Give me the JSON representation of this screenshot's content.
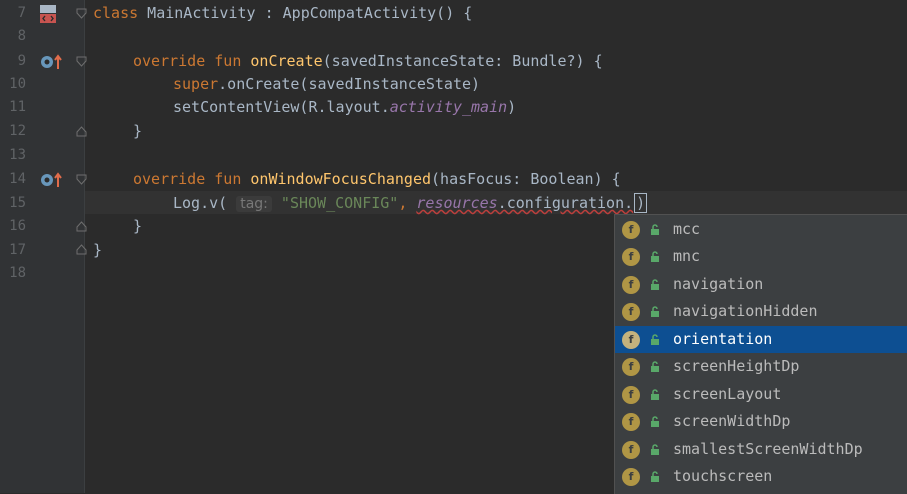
{
  "gutter": {
    "line_numbers": [
      "7",
      "8",
      "9",
      "10",
      "11",
      "12",
      "13",
      "14",
      "15",
      "16",
      "17",
      "18"
    ]
  },
  "code": {
    "line7": {
      "kw": "class",
      "rest": " MainActivity : AppCompatActivity() {"
    },
    "line9": {
      "kw": "override fun ",
      "fn": "onCreate",
      "rest": "(savedInstanceState: Bundle?) {"
    },
    "line10": {
      "kw": "super",
      "rest": ".onCreate(savedInstanceState)"
    },
    "line11": {
      "pre": "setContentView(R.layout.",
      "ital": "activity_main",
      "rest": ")"
    },
    "line12": "}",
    "line14": {
      "kw": "override fun ",
      "fn": "onWindowFocusChanged",
      "rest": "(hasFocus: Boolean) {"
    },
    "line15": {
      "pre": "Log.v(",
      "hint": "tag:",
      "str": "\"SHOW_CONFIG\"",
      "comma": ", ",
      "ital": "resources",
      "rest": ".configuration."
    },
    "line16": "}",
    "line17": "}"
  },
  "completion": {
    "items": [
      "mcc",
      "mnc",
      "navigation",
      "navigationHidden",
      "orientation",
      "screenHeightDp",
      "screenLayout",
      "screenWidthDp",
      "smallestScreenWidthDp",
      "touchscreen"
    ],
    "selected": "orientation",
    "field_icon_letter": "f"
  },
  "colors": {
    "background": "#2b2b2b",
    "keyword": "#cc7832",
    "function": "#ffc66d",
    "string": "#6a8759",
    "selection": "#0d4f92"
  }
}
